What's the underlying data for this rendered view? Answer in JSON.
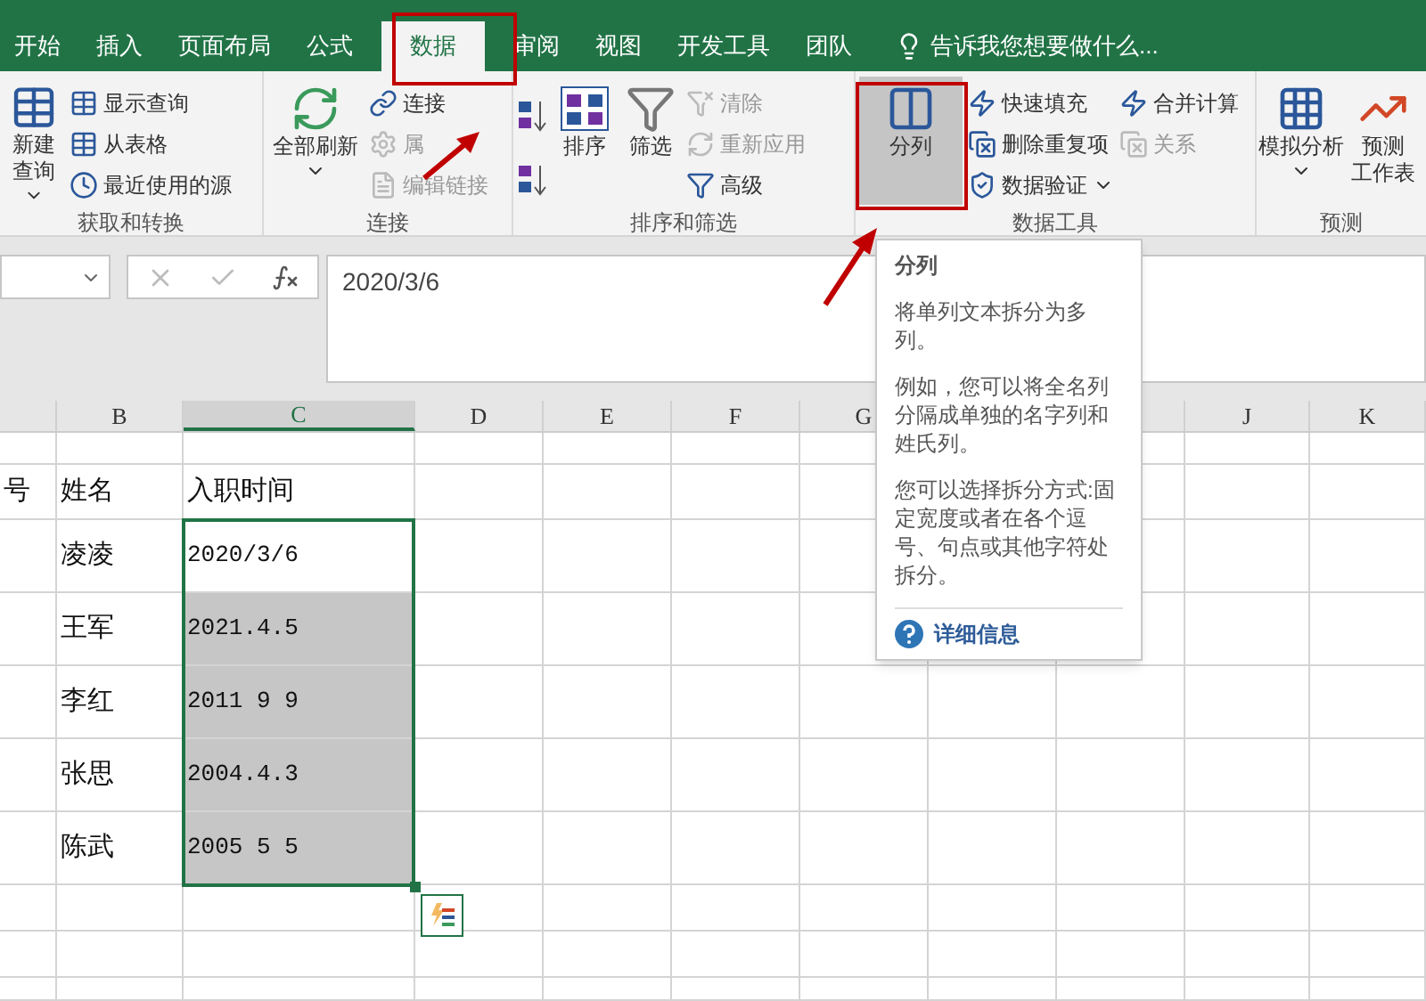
{
  "ribbon_tabs": [
    {
      "label": "开始",
      "selected": false
    },
    {
      "label": "插入",
      "selected": false
    },
    {
      "label": "页面布局",
      "selected": false
    },
    {
      "label": "公式",
      "selected": false
    },
    {
      "label": "数据",
      "selected": true
    },
    {
      "label": "审阅",
      "selected": false
    },
    {
      "label": "视图",
      "selected": false
    },
    {
      "label": "开发工具",
      "selected": false
    },
    {
      "label": "团队",
      "selected": false
    }
  ],
  "tell_me": {
    "placeholder": "告诉我您想要做什么..."
  },
  "ribbon_groups": [
    {
      "label": "获取和转换",
      "items": [
        {
          "kind": "large",
          "lines": [
            "新建",
            "查询"
          ],
          "dropdown": true,
          "disabled": false,
          "hovered": false
        },
        {
          "kind": "stack",
          "items": [
            {
              "label": "显示查询",
              "disabled": false,
              "dropdown": false
            },
            {
              "label": "从表格",
              "disabled": false,
              "dropdown": false
            },
            {
              "label": "最近使用的源",
              "disabled": false,
              "dropdown": false
            }
          ]
        }
      ]
    },
    {
      "label": "连接",
      "items": [
        {
          "kind": "large",
          "lines": [
            "全部刷新"
          ],
          "dropdown": true,
          "disabled": false,
          "hovered": false
        },
        {
          "kind": "stack",
          "items": [
            {
              "label": "连接",
              "disabled": false,
              "dropdown": false
            },
            {
              "label": "属",
              "disabled": true,
              "dropdown": false
            },
            {
              "label": "编辑链接",
              "disabled": true,
              "dropdown": false
            }
          ]
        }
      ]
    },
    {
      "label": "排序和筛选",
      "items": [
        {
          "kind": "sorticons"
        },
        {
          "kind": "large",
          "lines": [
            "排序"
          ],
          "dropdown": false,
          "disabled": false,
          "hovered": false
        },
        {
          "kind": "large",
          "lines": [
            "筛选"
          ],
          "dropdown": false,
          "disabled": false,
          "hovered": false
        },
        {
          "kind": "stack",
          "items": [
            {
              "label": "清除",
              "disabled": true,
              "dropdown": false
            },
            {
              "label": "重新应用",
              "disabled": true,
              "dropdown": false
            },
            {
              "label": "高级",
              "disabled": false,
              "dropdown": false
            }
          ]
        }
      ]
    },
    {
      "label": "数据工具",
      "items": [
        {
          "kind": "large",
          "lines": [
            "分列"
          ],
          "dropdown": false,
          "disabled": false,
          "hovered": true
        },
        {
          "kind": "stack",
          "items": [
            {
              "label": "快速填充",
              "disabled": false,
              "dropdown": false
            },
            {
              "label": "删除重复项",
              "disabled": false,
              "dropdown": false
            },
            {
              "label": "数据验证",
              "disabled": false,
              "dropdown": true
            }
          ]
        },
        {
          "kind": "stack",
          "items": [
            {
              "label": "合并计算",
              "disabled": false,
              "dropdown": false
            },
            {
              "label": "关系",
              "disabled": true,
              "dropdown": false
            }
          ]
        }
      ]
    },
    {
      "label": "预测",
      "items": [
        {
          "kind": "large",
          "lines": [
            "模拟分析"
          ],
          "dropdown": true,
          "disabled": false,
          "hovered": false
        },
        {
          "kind": "large",
          "lines": [
            "预测",
            "工作表"
          ],
          "dropdown": false,
          "disabled": false,
          "hovered": false
        }
      ]
    }
  ],
  "formula_bar": {
    "value": "2020/3/6"
  },
  "sheet": {
    "columns": [
      {},
      {
        "label": "B",
        "selected": false
      },
      {
        "label": "C",
        "selected": true
      },
      {
        "label": "D",
        "selected": false
      },
      {
        "label": "E",
        "selected": false
      },
      {
        "label": "F",
        "selected": false
      },
      {
        "label": "G",
        "selected": false
      },
      {},
      {},
      {
        "label": "J",
        "selected": false
      },
      {
        "label": "K",
        "selected": false
      }
    ],
    "rows": [
      {
        "selected": false
      },
      {
        "A": "号",
        "B": "姓名",
        "C": "入职时间",
        "selected": false
      },
      {
        "B": "凌凌",
        "C": "2020/3/6",
        "selected": true,
        "active": true
      },
      {
        "B": "王军",
        "C": "2021.4.5",
        "selected": true,
        "active": false
      },
      {
        "B": "李红",
        "C": "2011 9 9",
        "selected": true,
        "active": false
      },
      {
        "B": "张思",
        "C": "2004.4.3",
        "selected": true,
        "active": false
      },
      {
        "B": "陈武",
        "C": "2005 5 5",
        "selected": true,
        "active": false
      },
      {
        "selected": false
      },
      {
        "selected": false
      },
      {
        "selected": false
      }
    ]
  },
  "tooltip": {
    "title": "分列",
    "paragraphs": [
      "将单列文本拆分为多列。",
      "例如，您可以将全名列分隔成单独的名字列和姓氏列。",
      "您可以选择拆分方式:固定宽度或者在各个逗号、句点或其他字符处拆分。"
    ],
    "link": "详细信息"
  }
}
